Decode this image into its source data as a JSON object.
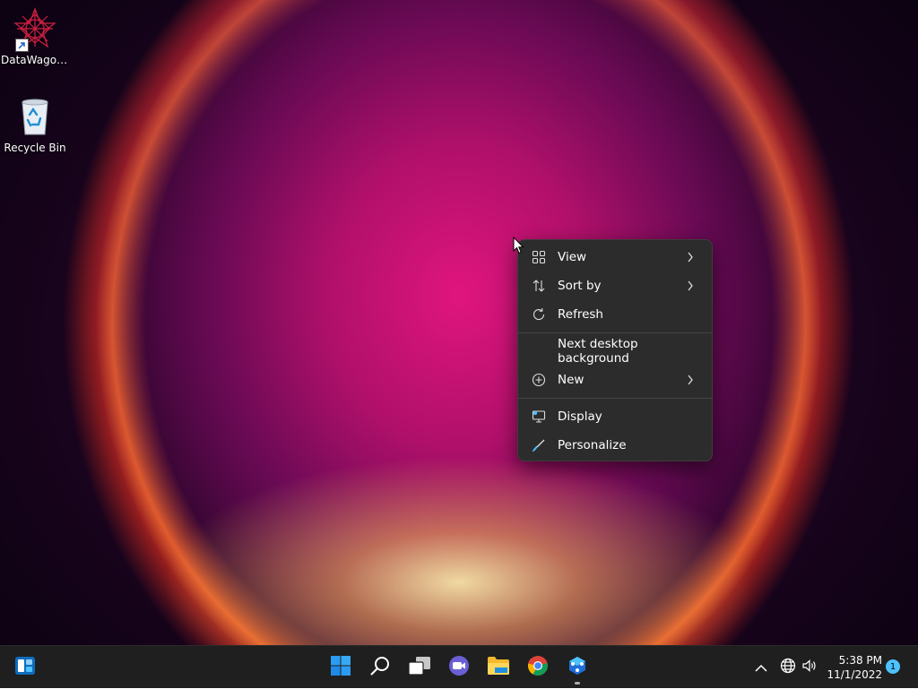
{
  "desktop": {
    "icons": [
      {
        "label": "DataWagon...",
        "icon": "datawagon-app-icon"
      },
      {
        "label": "Recycle Bin",
        "icon": "recycle-bin-icon"
      }
    ]
  },
  "context_menu": {
    "items": [
      {
        "label": "View",
        "icon": "grid-icon",
        "submenu": true
      },
      {
        "label": "Sort by",
        "icon": "sort-arrows-icon",
        "submenu": true
      },
      {
        "label": "Refresh",
        "icon": "refresh-icon",
        "submenu": false
      },
      {
        "label": "Next desktop background",
        "icon": "",
        "submenu": false
      },
      {
        "label": "New",
        "icon": "plus-circle-icon",
        "submenu": true
      },
      {
        "label": "Display",
        "icon": "display-icon",
        "submenu": false
      },
      {
        "label": "Personalize",
        "icon": "brush-icon",
        "submenu": false
      }
    ]
  },
  "taskbar": {
    "apps": [
      "widgets",
      "start",
      "search",
      "task-view",
      "chat",
      "file-explorer",
      "chrome",
      "datawagon"
    ],
    "clock": {
      "time": "5:38 PM",
      "date": "11/1/2022"
    },
    "notification_count": "1"
  },
  "colors": {
    "menu_bg": "#2c2c2c",
    "taskbar_bg": "#1f1f1f",
    "accent": "#4cc2ff"
  }
}
